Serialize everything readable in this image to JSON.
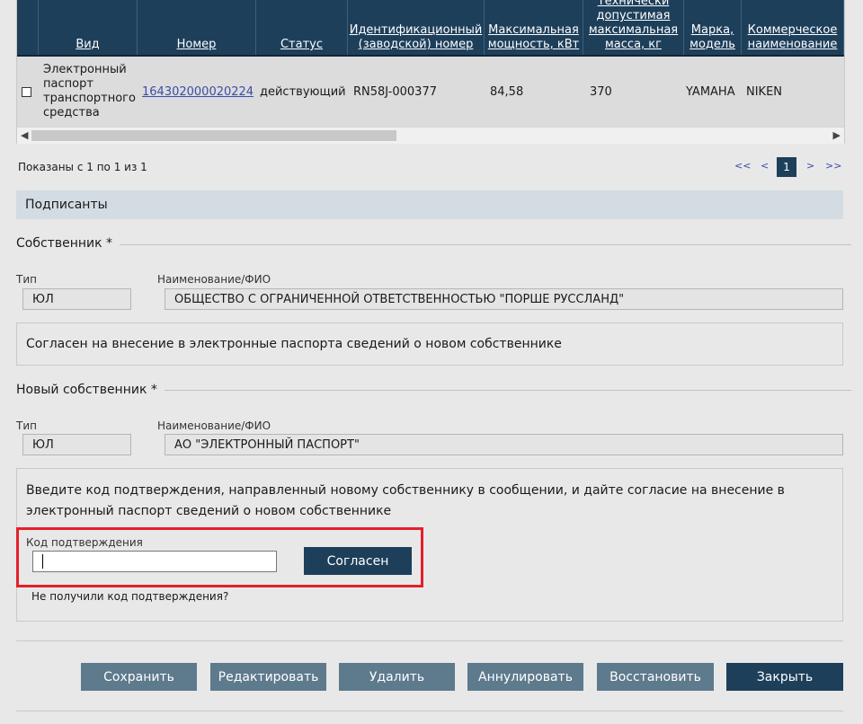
{
  "table": {
    "columns": [
      "Вид",
      "Номер",
      "Статус",
      "Идентификационный (заводской) номер",
      "Максимальная мощность, кВт",
      "Технически допустимая максимальная масса, кг",
      "Марка, модель",
      "Коммерческое наименование"
    ],
    "row": {
      "vid": "Электронный паспорт транспортного средства",
      "nomer": "164302000020224",
      "status": "действующий",
      "vin": "RN58J-000377",
      "power": "84,58",
      "mass": "370",
      "brand": "YAMAHA",
      "commercial": "NIKEN"
    }
  },
  "pager": {
    "info": "Показаны с 1 по 1 из 1",
    "first": "<<",
    "prev": "<",
    "current": "1",
    "next": ">",
    "last": ">>"
  },
  "section": {
    "title": "Подписанты"
  },
  "owner": {
    "legend": "Собственник *",
    "type_label": "Тип",
    "type_value": "ЮЛ",
    "name_label": "Наименование/ФИО",
    "name_value": "ОБЩЕСТВО С ОГРАНИЧЕННОЙ ОТВЕТСТВЕННОСТЬЮ \"ПОРШЕ РУССЛАНД\"",
    "consent_text": "Согласен на внесение в электронные паспорта сведений о новом собственнике"
  },
  "new_owner": {
    "legend": "Новый собственник *",
    "type_label": "Тип",
    "type_value": "ЮЛ",
    "name_label": "Наименование/ФИО",
    "name_value": "АО \"ЭЛЕКТРОННЫЙ ПАСПОРТ\"",
    "instruction_line1": "Введите код подтверждения, направленный новому собственнику в сообщении, и дайте согласие на внесение в",
    "instruction_line2": "электронный паспорт сведений о новом собственнике",
    "code_label": "Код подтверждения",
    "code_value": "",
    "agree_label": "Согласен",
    "no_code_link": "Не получили код подтверждения?"
  },
  "actions": {
    "save": "Сохранить",
    "edit": "Редактировать",
    "delete": "Удалить",
    "cancel": "Аннулировать",
    "restore": "Восстановить",
    "close": "Закрыть"
  },
  "colors": {
    "header_bg": "#1e3f5a",
    "button_gray": "#5e7a8d",
    "button_dark": "#1e3f5a",
    "highlight": "#e3202a",
    "link": "#3b4ca8"
  }
}
